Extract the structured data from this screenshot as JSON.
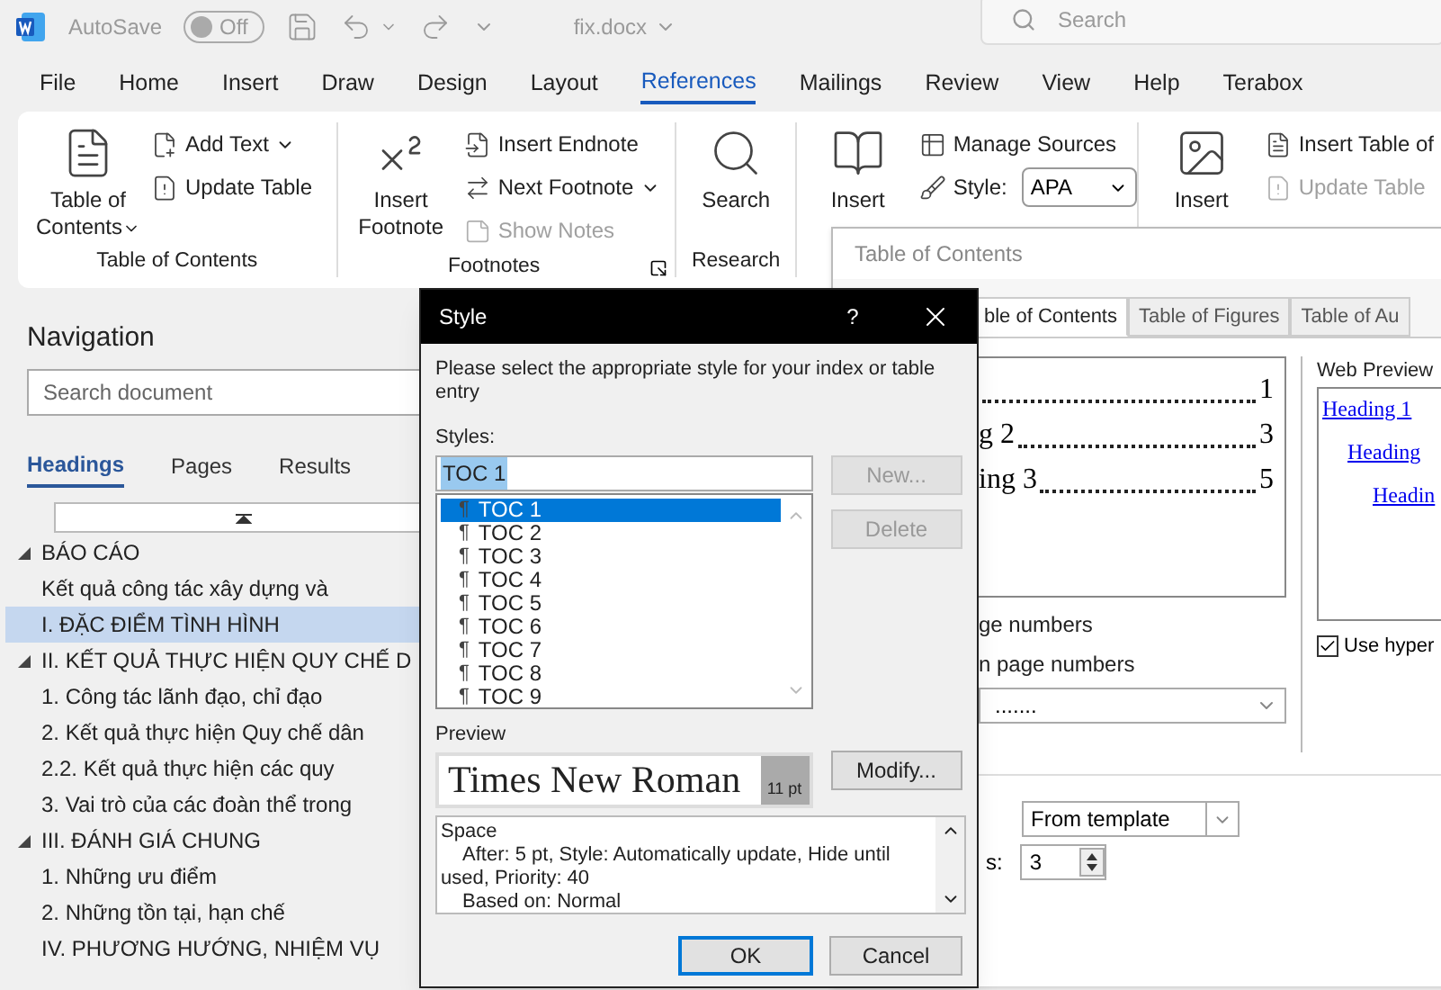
{
  "title_bar": {
    "autosave": {
      "label": "AutoSave",
      "on": false,
      "state_text": "Off"
    },
    "file_name": "fix.docx",
    "search": {
      "placeholder": "Search"
    }
  },
  "menu_tabs": [
    {
      "label": "File",
      "selected": false
    },
    {
      "label": "Home",
      "selected": false
    },
    {
      "label": "Insert",
      "selected": false
    },
    {
      "label": "Draw",
      "selected": false
    },
    {
      "label": "Design",
      "selected": false
    },
    {
      "label": "Layout",
      "selected": false
    },
    {
      "label": "References",
      "selected": true
    },
    {
      "label": "Mailings",
      "selected": false
    },
    {
      "label": "Review",
      "selected": false
    },
    {
      "label": "View",
      "selected": false
    },
    {
      "label": "Help",
      "selected": false
    },
    {
      "label": "Terabox",
      "selected": false
    }
  ],
  "ribbon": {
    "toc_group": {
      "label": "Table of Contents",
      "big_button": "Table of Contents",
      "add_text": "Add Text",
      "update_table": "Update Table"
    },
    "footnotes_group": {
      "label": "Footnotes",
      "big_button": "Insert Footnote",
      "insert_endnote": "Insert Endnote",
      "next_footnote": "Next Footnote",
      "show_notes": {
        "label": "Show Notes",
        "disabled": true
      }
    },
    "research_group": {
      "label": "Research",
      "search": "Search"
    },
    "citations_group": {
      "big_button": "Insert",
      "manage_sources": "Manage Sources",
      "style_label": "Style:",
      "style_value": "APA"
    },
    "captions_group": {
      "big_button": "Insert",
      "insert_table": "Insert Table of",
      "update_table": {
        "label": "Update Table",
        "disabled": true
      }
    }
  },
  "navigation": {
    "title": "Navigation",
    "search": {
      "placeholder": "Search document"
    },
    "tabs": [
      {
        "label": "Headings",
        "selected": true
      },
      {
        "label": "Pages",
        "selected": false
      },
      {
        "label": "Results",
        "selected": false
      }
    ],
    "headings": [
      {
        "text": "BÁO CÁO",
        "selected": false,
        "expanded": true,
        "children": [
          {
            "text": "Kết quả công tác xây dựng và",
            "selected": false
          }
        ]
      },
      {
        "text": "I. ĐẶC ĐIỂM TÌNH HÌNH",
        "selected": true
      },
      {
        "text": "II. KẾT QUẢ THỰC HIỆN QUY CHẾ D",
        "selected": false,
        "expanded": true,
        "children": [
          {
            "text": "1. Công tác lãnh đạo, chỉ đạo",
            "selected": false
          },
          {
            "text": "2. Kết quả thực hiện Quy chế dân",
            "selected": false
          },
          {
            "text": "2.2. Kết quả thực hiện các quy",
            "selected": false
          },
          {
            "text": "3. Vai trò của các đoàn thể trong",
            "selected": false
          }
        ]
      },
      {
        "text": "III. ĐÁNH GIÁ CHUNG",
        "selected": false,
        "expanded": true,
        "children": [
          {
            "text": "1. Những ưu điểm",
            "selected": false
          },
          {
            "text": "2. Những tồn tại, hạn chế",
            "selected": false
          }
        ]
      },
      {
        "text": "IV. PHƯƠNG HƯỚNG, NHIỆM VỤ",
        "selected": false
      }
    ]
  },
  "toc_dialog": {
    "title": "Table of Contents",
    "tabs": [
      {
        "label": "ble of Contents",
        "selected": true
      },
      {
        "label": "Table of Figures",
        "selected": false
      },
      {
        "label": "Table of Au",
        "selected": false
      }
    ],
    "print_preview": [
      {
        "page": "1"
      },
      {
        "text": "g 2",
        "page": "3"
      },
      {
        "text": "ing 3",
        "page": "5"
      }
    ],
    "web_preview": {
      "label": "Web Preview",
      "links": [
        "Heading 1",
        "Heading",
        "Headin"
      ]
    },
    "options": [
      {
        "label": "ge numbers"
      },
      {
        "label": "n page numbers"
      }
    ],
    "tab_leader": ".......",
    "use_hyperlinks": {
      "label": "Use hyper",
      "checked": true
    },
    "formats": "From template",
    "levels_label": "s:",
    "levels_value": "3"
  },
  "style_dialog": {
    "title": "Style",
    "help": "?",
    "instruction": "Please select the appropriate style for your index or table entry",
    "styles_label": "Styles:",
    "style_input": "TOC 1",
    "styles": [
      {
        "name": "TOC 1",
        "selected": true
      },
      {
        "name": "TOC 2",
        "selected": false
      },
      {
        "name": "TOC 3",
        "selected": false
      },
      {
        "name": "TOC 4",
        "selected": false
      },
      {
        "name": "TOC 5",
        "selected": false
      },
      {
        "name": "TOC 6",
        "selected": false
      },
      {
        "name": "TOC 7",
        "selected": false
      },
      {
        "name": "TOC 8",
        "selected": false
      },
      {
        "name": "TOC 9",
        "selected": false
      }
    ],
    "style_marker": "¶",
    "new_button": {
      "label": "New...",
      "disabled": true
    },
    "delete_button": {
      "label": "Delete",
      "disabled": true
    },
    "preview_label": "Preview",
    "preview_font": "Times New Roman",
    "preview_size": "11 pt",
    "modify_button": "Modify...",
    "description": [
      "Space",
      "After:  5 pt, Style: Automatically update, Hide until used, Priority: 40",
      "Based on: Normal"
    ],
    "ok": "OK",
    "cancel": "Cancel"
  }
}
